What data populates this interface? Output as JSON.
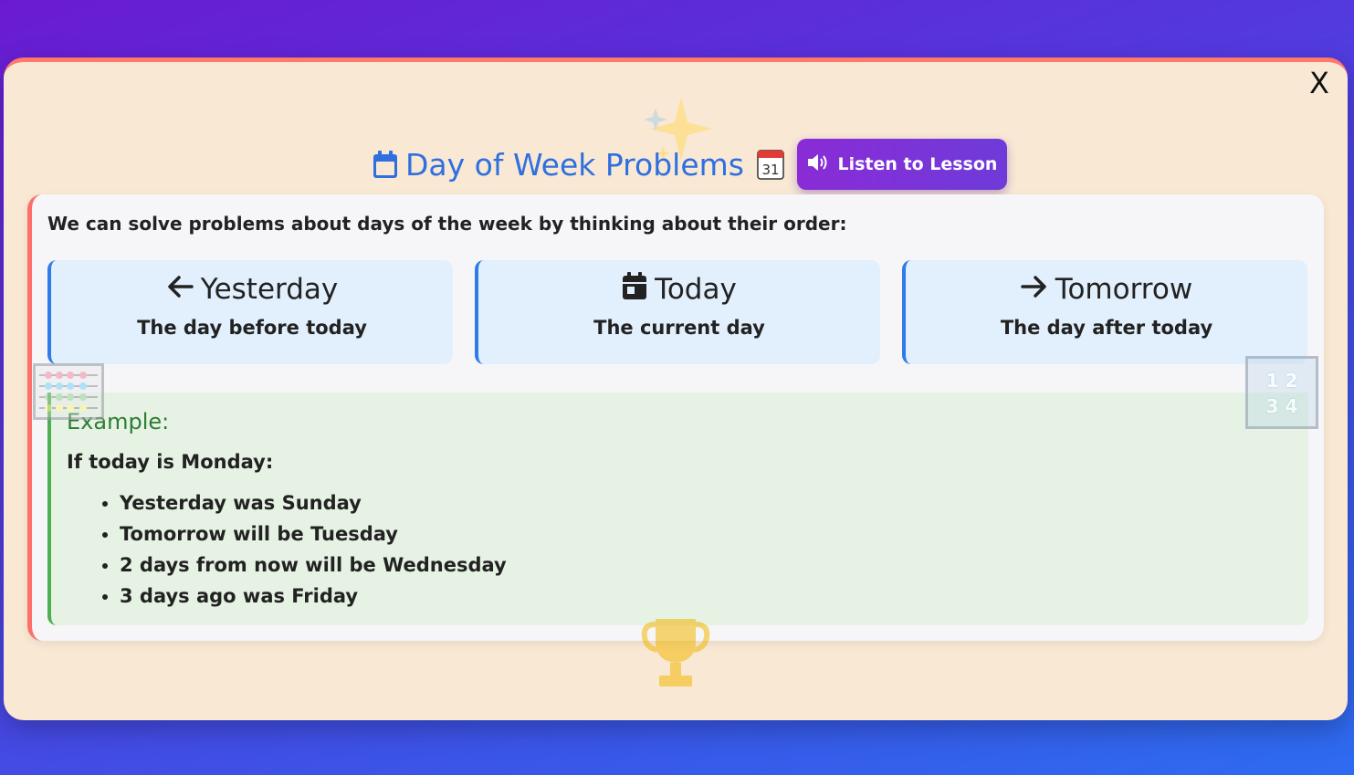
{
  "modal": {
    "close_label": "X",
    "title": "Day of Week Problems",
    "listen_button_label": "Listen to Lesson"
  },
  "lesson": {
    "intro": "We can solve problems about days of the week by thinking about their order:",
    "days": [
      {
        "icon": "arrow-left-icon",
        "heading": "Yesterday",
        "description": "The day before today"
      },
      {
        "icon": "calendar-day-icon",
        "heading": "Today",
        "description": "The current day"
      },
      {
        "icon": "arrow-right-icon",
        "heading": "Tomorrow",
        "description": "The day after today"
      }
    ],
    "example": {
      "title": "Example:",
      "intro": "If today is Monday:",
      "items": [
        "Yesterday was Sunday",
        "Tomorrow will be Tuesday",
        "2 days from now will be Wednesday",
        "3 days ago was Friday"
      ]
    }
  },
  "decorations": {
    "numbers_tile_row1": "1 2",
    "numbers_tile_row2": "3 4",
    "calendar_emoji_number": "31"
  },
  "colors": {
    "title_blue": "#2f6fe0",
    "listen_purple": "#8a2bd6",
    "card_accent_red": "#ff6f6a",
    "day_box_bg": "#e2effc",
    "example_bg": "#e6f3e4",
    "example_green": "#2e7d32",
    "modal_bg": "#f9e8d4"
  }
}
